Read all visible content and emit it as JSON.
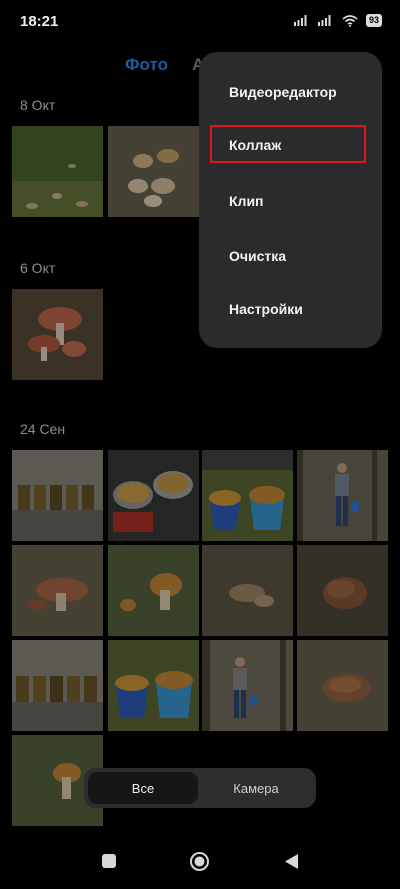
{
  "status": {
    "time": "18:21",
    "battery": "93"
  },
  "tabs": {
    "photo": "Фото",
    "albums": "А"
  },
  "sections": [
    {
      "date": "8 Окт",
      "photos": [
        "mushrooms-on-moss",
        "mushroom-cluster"
      ]
    },
    {
      "date": "6 Окт",
      "photos": [
        "mushrooms-on-forest-floor"
      ]
    },
    {
      "date": "24 Сен",
      "photos": [
        "jars-on-shelf",
        "mushrooms-in-pots",
        "mushrooms-in-buckets",
        "person-in-forest",
        "mushroom-in-grass",
        "mushroom-in-needles",
        "mushroom-on-ground",
        "mushroom-close-up",
        "jars-on-shelf-2",
        "buckets-on-grass",
        "person-with-bucket",
        "mushroom-in-leaves",
        "mushroom-in-grass-2"
      ]
    }
  ],
  "menu": {
    "items": [
      "Видеоредактор",
      "Коллаж",
      "Клип",
      "Очистка",
      "Настройки"
    ],
    "highlighted": "Коллаж",
    "highlight_color": "#e0161c"
  },
  "filter": {
    "all": "Все",
    "camera": "Камера",
    "selected": "Все"
  },
  "colors": {
    "accent": "#2a8cf5",
    "background": "#000000",
    "menu": "#2b2b2d"
  }
}
